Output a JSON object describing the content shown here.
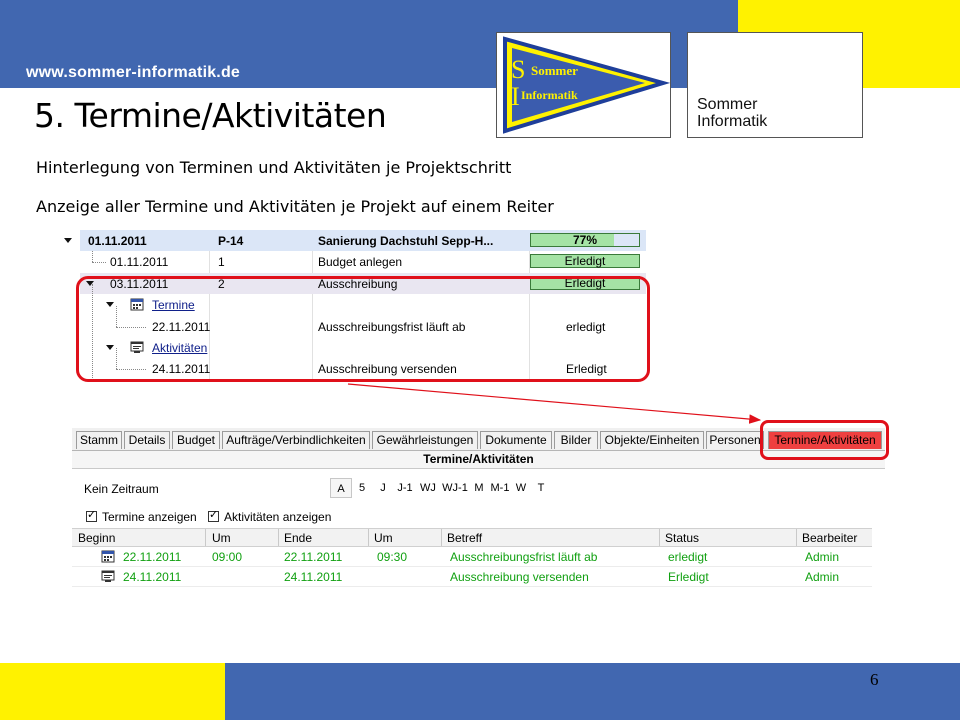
{
  "slide": {
    "site_url": "www.sommer-informatik.de",
    "title": "5. Termine/Aktivitäten",
    "line1": "Hinterlegung von Terminen und Aktivitäten je Projektschritt",
    "line2": "Anzeige aller Termine und Aktivitäten je Projekt auf einem Reiter",
    "page_number": "6"
  },
  "logos": {
    "logo1": {
      "line1": "Sommer",
      "line2": "Informatik"
    },
    "logo2": {
      "line1": "Sommer",
      "line2": "Informatik"
    }
  },
  "colors": {
    "band_blue": "#4167b0",
    "band_yellow": "#fff200",
    "highlight_red": "#e0101a",
    "status_green": "#a5e3a5",
    "grid_text_green": "#11a011"
  },
  "tree": {
    "project": {
      "date": "01.11.2011",
      "code": "P-14",
      "name": "Sanierung Dachstuhl Sepp-H...",
      "progress_label": "77%",
      "progress": 0.77
    },
    "step1": {
      "date": "01.11.2011",
      "nr": "1",
      "name": "Budget anlegen",
      "status": "Erledigt"
    },
    "step2": {
      "date": "03.11.2011",
      "nr": "2",
      "name": "Ausschreibung",
      "status": "Erledigt"
    },
    "termine_label": "Termine",
    "termin": {
      "date": "22.11.2011",
      "name": "Ausschreibungsfrist läuft ab",
      "status": "erledigt"
    },
    "aktivitaeten_label": "Aktivitäten",
    "aktivitaet": {
      "date": "24.11.2011",
      "name": "Ausschreibung versenden",
      "status": "Erledigt"
    }
  },
  "panel": {
    "tabs": [
      "Stamm",
      "Details",
      "Budget",
      "Aufträge/Verbindlichkeiten",
      "Gewährleistungen",
      "Dokumente",
      "Bilder",
      "Objekte/Einheiten",
      "Personen",
      "Termine/Aktivitäten"
    ],
    "header": "Termine/Aktivitäten",
    "zeitraum_label": "Kein Zeitraum",
    "periods": [
      "A",
      "5",
      "J",
      "J-1",
      "WJ",
      "WJ-1",
      "M",
      "M-1",
      "W",
      "T"
    ],
    "active_period": "A",
    "checkbox_termine": "Termine anzeigen",
    "checkbox_aktivitaeten": "Aktivitäten anzeigen",
    "columns": [
      "Beginn",
      "Um",
      "Ende",
      "Um",
      "Betreff",
      "Status",
      "Bearbeiter"
    ],
    "rows": [
      {
        "icon": "calendar-icon",
        "beginn": "22.11.2011",
        "um1": "09:00",
        "ende": "22.11.2011",
        "um2": "09:30",
        "betreff": "Ausschreibungsfrist läuft ab",
        "status": "erledigt",
        "bearbeiter": "Admin"
      },
      {
        "icon": "activity-icon",
        "beginn": "24.11.2011",
        "um1": "",
        "ende": "24.11.2011",
        "um2": "",
        "betreff": "Ausschreibung versenden",
        "status": "Erledigt",
        "bearbeiter": "Admin"
      }
    ]
  }
}
